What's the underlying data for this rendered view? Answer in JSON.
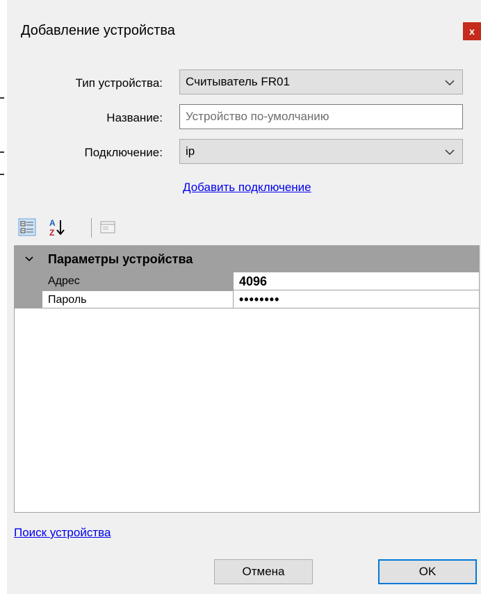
{
  "dialog": {
    "title": "Добавление устройства",
    "close_label": "x"
  },
  "form": {
    "device_type": {
      "label": "Тип устройства:",
      "value": "Считыватель FR01"
    },
    "name": {
      "label": "Название:",
      "value": "",
      "placeholder": "Устройство по-умолчанию"
    },
    "connection": {
      "label": "Подключение:",
      "value": "ip"
    },
    "add_connection_link": "Добавить подключение"
  },
  "toolbar": {
    "categorized_icon": "categorized-view-icon",
    "alphabetical_icon": "sort-az-icon",
    "property_pages_icon": "property-pages-icon"
  },
  "property_grid": {
    "category_title": "Параметры устройства",
    "rows": [
      {
        "name": "Адрес",
        "value": "4096"
      },
      {
        "name": "Пароль",
        "value": "••••••••"
      }
    ]
  },
  "search_link": "Поиск устройства",
  "buttons": {
    "cancel": "Отмена",
    "ok": "OK"
  },
  "colors": {
    "close_bg": "#c42b1c",
    "link": "#0000ee",
    "ok_border": "#0078d7",
    "grid_header": "#a0a0a0"
  }
}
